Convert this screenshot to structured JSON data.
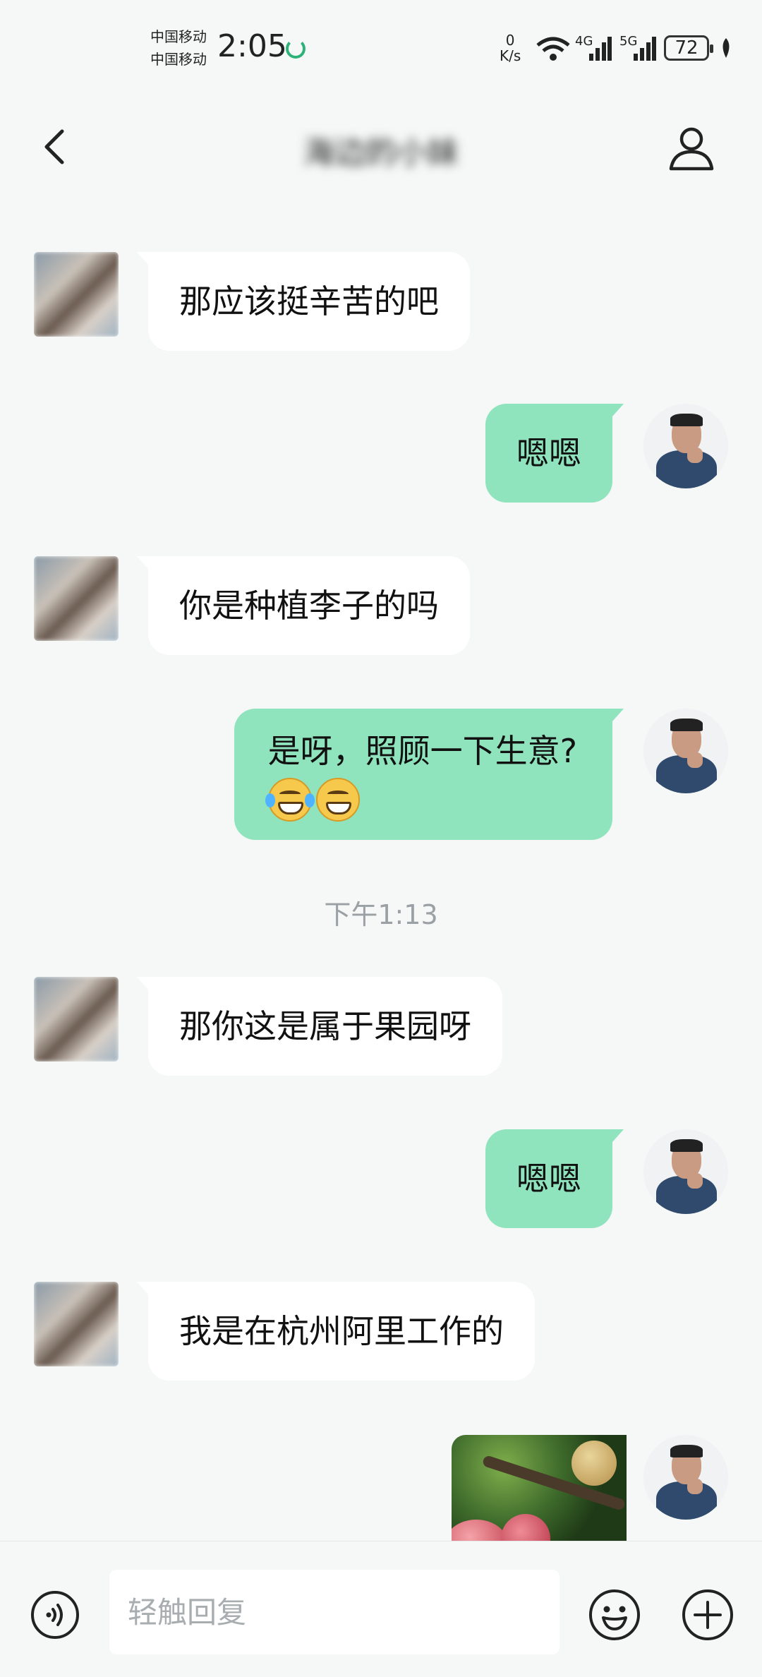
{
  "status_bar": {
    "carrier_1": "中国移动",
    "carrier_2": "中国移动",
    "time": "2:05",
    "net_speed_value": "0",
    "net_speed_unit": "K/s",
    "signal_1_label": "4G",
    "signal_2_label": "5G",
    "battery": "72"
  },
  "header": {
    "title": "海边的小妹"
  },
  "messages": [
    {
      "side": "left",
      "text": "那应该挺辛苦的吧"
    },
    {
      "side": "right",
      "text": "嗯嗯"
    },
    {
      "side": "left",
      "text": "你是种植李子的吗"
    },
    {
      "side": "right",
      "text": "是呀，照顾一下生意?",
      "emojis": [
        "laughing-tears-emoji",
        "grinning-emoji"
      ]
    },
    {
      "side": "left",
      "text": "那你这是属于果园呀"
    },
    {
      "side": "right",
      "text": "嗯嗯"
    },
    {
      "side": "left",
      "text": "我是在杭州阿里工作的"
    },
    {
      "side": "right",
      "type": "image",
      "image": "fruit-tree-photo"
    }
  ],
  "timestamp": "下午1:13",
  "input_bar": {
    "placeholder": "轻触回复"
  },
  "colors": {
    "background": "#f5f8f7",
    "bubble_self": "#8fe3bd",
    "bubble_other": "#ffffff",
    "timestamp": "#9aa0a4"
  }
}
